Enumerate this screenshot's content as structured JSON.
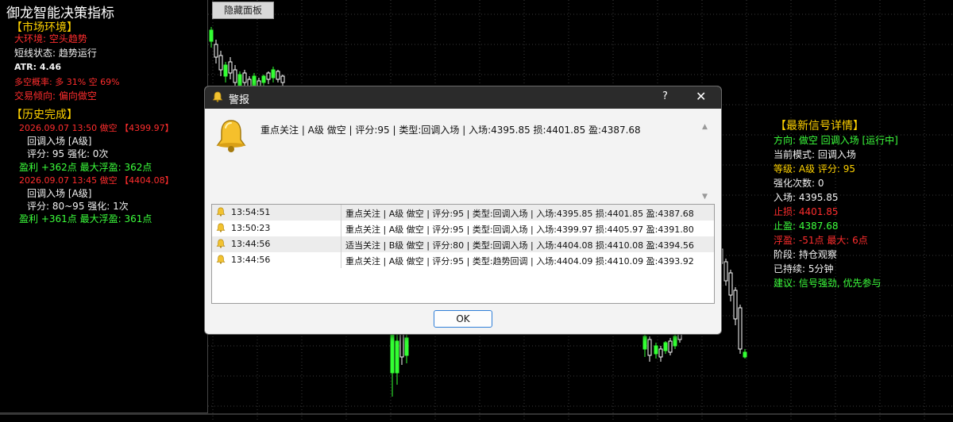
{
  "left_panel": {
    "title": "御龙智能决策指标",
    "market_header": "【市场环境】",
    "big_env": "大环境: 空头趋势",
    "short_state": "短线状态: 趋势运行",
    "atr": "ATR: 4.46",
    "prob": "多空概率: 多 31%  空 69%",
    "tendency": "交易倾向: 偏向做空",
    "history_header": "【历史完成】",
    "records": [
      {
        "line1": "2026.09.07 13:50 做空 【4399.97】",
        "line2": "回调入场 [A级]",
        "line3": "评分: 95  强化: 0次",
        "line4": "盈利 +362点  最大浮盈: 362点"
      },
      {
        "line1": "2026.09.07 13:45 做空 【4404.08】",
        "line2": "回调入场 [A级]",
        "line3": "评分: 80~95  强化: 1次",
        "line4": "盈利 +361点  最大浮盈: 361点"
      }
    ]
  },
  "hide_button": "隐藏面板",
  "right_panel": {
    "header": "【最新信号详情】",
    "direction": "方向: 做空 回调入场 [运行中]",
    "mode": "当前模式: 回调入场",
    "grade": "等级: A级  评分: 95",
    "reinforce": "强化次数: 0",
    "entry": "入场: 4395.85",
    "stop": "止损: 4401.85",
    "take": "止盈: 4387.68",
    "float": "浮盈: -51点  最大: 6点",
    "stage": "阶段: 持仓观察",
    "held": "已持续: 5分钟",
    "advice": "建议: 信号强劲, 优先参与"
  },
  "dialog": {
    "title": "警报",
    "help": "?",
    "close": "✕",
    "message": "重点关注 | A级 做空 | 评分:95 | 类型:回调入场 | 入场:4395.85 损:4401.85 盈:4387.68",
    "rows": [
      {
        "time": "13:54:51",
        "text": "重点关注 | A级 做空 | 评分:95 | 类型:回调入场 | 入场:4395.85 损:4401.85 盈:4387.68"
      },
      {
        "time": "13:50:23",
        "text": "重点关注 | A级 做空 | 评分:95 | 类型:回调入场 | 入场:4399.97 损:4405.97 盈:4391.80"
      },
      {
        "time": "13:44:56",
        "text": "适当关注 | B级 做空 | 评分:80 | 类型:回调入场 | 入场:4404.08 损:4410.08 盈:4394.56"
      },
      {
        "time": "13:44:56",
        "text": "重点关注 | A级 做空 | 评分:95 | 类型:趋势回调 | 入场:4404.09 损:4410.09 盈:4393.92"
      }
    ],
    "ok": "OK"
  },
  "colors": {
    "bull": "#33ff33",
    "bear": "#ffffff",
    "grid": "#3a3a3a",
    "accent_yellow": "#ffd200",
    "accent_red": "#ff2d2d",
    "accent_green": "#3cff3c"
  }
}
